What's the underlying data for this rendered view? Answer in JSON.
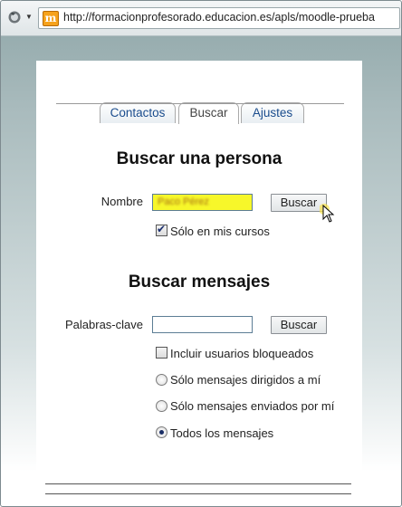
{
  "browser": {
    "url": "http://formacionprofesorado.educacion.es/apls/moodle-prueba",
    "favicon_letter": "m"
  },
  "tabs": [
    {
      "label": "Contactos",
      "active": false
    },
    {
      "label": "Buscar",
      "active": true
    },
    {
      "label": "Ajustes",
      "active": false
    }
  ],
  "search_person": {
    "heading": "Buscar una persona",
    "name_label": "Nombre",
    "name_value": "Paco Pérez",
    "search_button": "Buscar",
    "only_my_courses_label": "Sólo en mis cursos",
    "only_my_courses_checked": true
  },
  "search_messages": {
    "heading": "Buscar mensajes",
    "keywords_label": "Palabras-clave",
    "keywords_value": "",
    "search_button": "Buscar",
    "include_blocked_label": "Incluir usuarios bloqueados",
    "include_blocked_checked": false,
    "options": [
      {
        "label": "Sólo mensajes dirigidos a mí",
        "selected": false
      },
      {
        "label": "Sólo mensajes enviados por mí",
        "selected": false
      },
      {
        "label": "Todos los mensajes",
        "selected": true
      }
    ]
  },
  "colors": {
    "highlight_input": "#f7f72a",
    "tab_link": "#1a4c8d",
    "window_background": "#8fa6a8"
  }
}
